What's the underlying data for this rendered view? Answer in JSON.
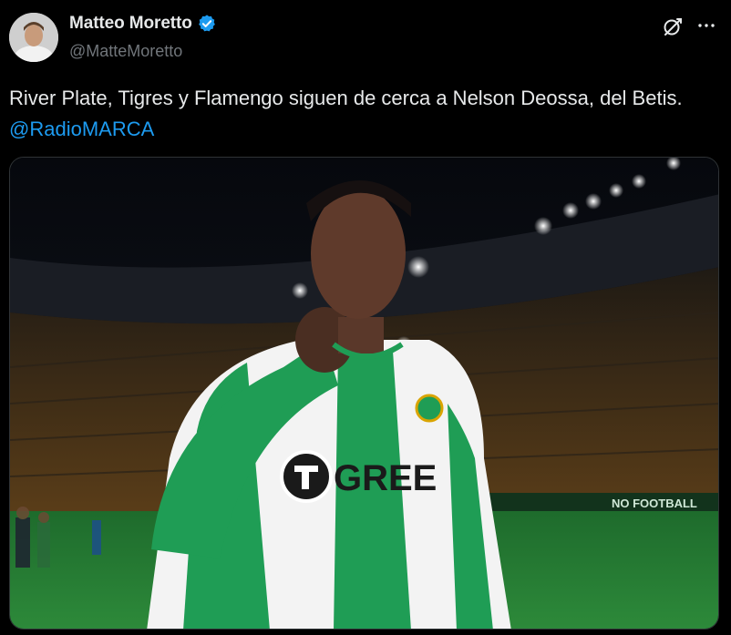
{
  "author": {
    "name": "Matteo Moretto",
    "handle": "@MatteMoretto",
    "verified": true
  },
  "tweet": {
    "text_before": "River Plate, Tigres y Flamengo siguen de cerca a Nelson Deossa, del Betis. ",
    "mention": "@RadioMARCA"
  },
  "media": {
    "alt": "photo-player-betis-kit",
    "sponsor_text": "GREE",
    "ad_board_text": "NO FOOTBALL"
  },
  "colors": {
    "accent": "#1d9bf0",
    "text": "#e7e9ea",
    "muted": "#71767b",
    "background": "#000000",
    "kit_green": "#1f9d55"
  },
  "icons": {
    "verified": "verified-badge-icon",
    "grok": "grok-icon",
    "more": "more-icon"
  }
}
